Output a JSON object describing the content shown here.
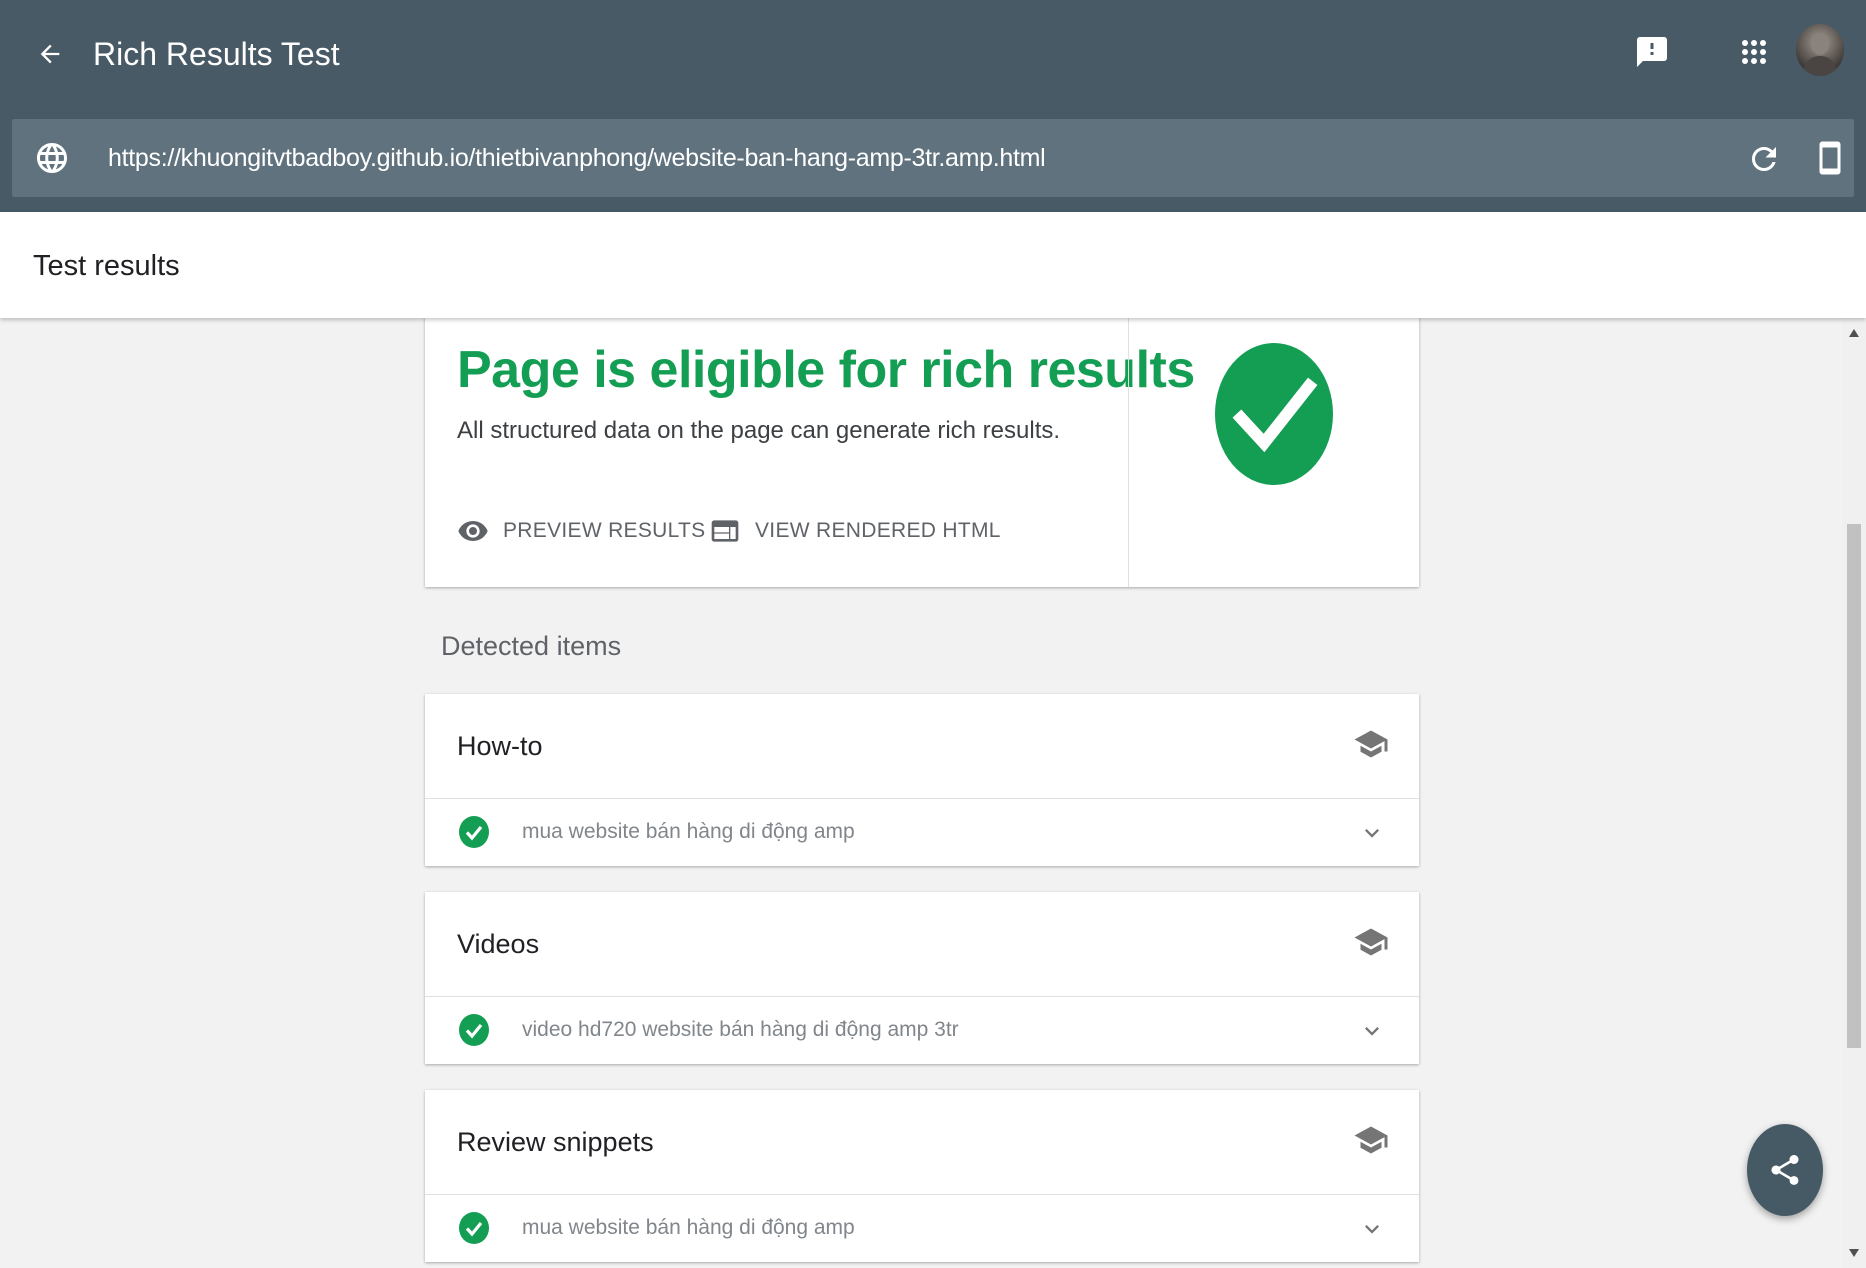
{
  "app": {
    "title": "Rich Results Test"
  },
  "url_bar": {
    "url": "https://khuongitvtbadboy.github.io/thietbivanphong/website-ban-hang-amp-3tr.amp.html"
  },
  "subheader": {
    "title": "Test results"
  },
  "result": {
    "headline": "Page is eligible for rich results",
    "description": "All structured data on the page can generate rich results.",
    "preview_label": "PREVIEW RESULTS",
    "view_html_label": "VIEW RENDERED HTML",
    "status_color": "#149e54"
  },
  "detected": {
    "label": "Detected items",
    "items": [
      {
        "name": "How-to",
        "entry": "mua website bán hàng di động amp"
      },
      {
        "name": "Videos",
        "entry": "video hd720 website bán hàng di động amp 3tr"
      },
      {
        "name": "Review snippets",
        "entry": "mua website bán hàng di động amp"
      }
    ]
  },
  "colors": {
    "appbar": "#475a66",
    "urlbar": "#5f727e",
    "accent_green": "#149e54",
    "fab": "#455a64"
  },
  "icons": {
    "back": "arrow-left-icon",
    "feedback": "feedback-icon",
    "apps": "apps-grid-icon",
    "globe": "globe-icon",
    "refresh": "refresh-icon",
    "device": "smartphone-icon",
    "preview": "eye-icon",
    "html": "web-page-icon",
    "item_type": "school-cap-icon",
    "status": "check-circle-icon",
    "expand": "chevron-down-icon",
    "share": "share-icon"
  }
}
